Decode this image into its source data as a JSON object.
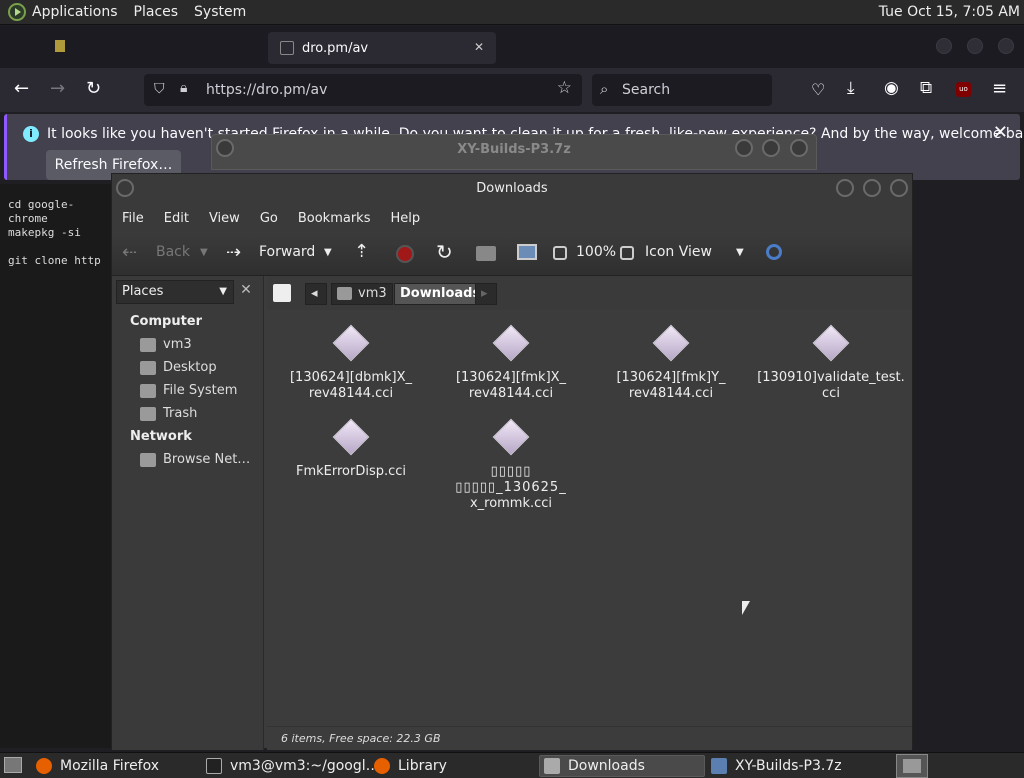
{
  "top_panel": {
    "menus": [
      "Applications",
      "Places",
      "System"
    ],
    "clock": "Tue Oct 15,  7:05 AM"
  },
  "firefox": {
    "tab_title": "dro.pm/av",
    "tab_close": "✕",
    "url": "https://dro.pm/av",
    "search_placeholder": "Search",
    "notice": "It looks like you haven't started Firefox in a while. Do you want to clean it up for a fresh, like-new experience? And by the way, welcome back!",
    "refresh_button": "Refresh Firefox…",
    "notice_close": "✕"
  },
  "terminal": {
    "lines": [
      "cd google-chrome",
      "makepkg -si",
      "",
      "git clone http"
    ]
  },
  "xy_window": {
    "title": "XY-Builds-P3.7z"
  },
  "caja": {
    "title": "Downloads",
    "menu": [
      "File",
      "Edit",
      "View",
      "Go",
      "Bookmarks",
      "Help"
    ],
    "toolbar": {
      "back": "Back",
      "forward": "Forward",
      "zoom": "100%",
      "view_mode": "Icon View"
    },
    "sidebar": {
      "selector": "Places",
      "computer_heading": "Computer",
      "computer_items": [
        "vm3",
        "Desktop",
        "File System",
        "Trash"
      ],
      "network_heading": "Network",
      "network_items": [
        "Browse Net…"
      ]
    },
    "pathbar": {
      "parent": "vm3",
      "current": "Downloads"
    },
    "files": [
      {
        "line1": "[130624][dbmk]X_",
        "line2": "rev48144.cci",
        "line3": ""
      },
      {
        "line1": "[130624][fmk]X_",
        "line2": "rev48144.cci",
        "line3": ""
      },
      {
        "line1": "[130624][fmk]Y_",
        "line2": "rev48144.cci",
        "line3": ""
      },
      {
        "line1": "[130910]validate_test.",
        "line2": "cci",
        "line3": ""
      },
      {
        "line1": "FmkErrorDisp.cci",
        "line2": "",
        "line3": ""
      },
      {
        "line1": "▯▯▯▯▯",
        "line2": "▯▯▯▯▯_130625_",
        "line3": "x_rommk.cci"
      }
    ],
    "status": "6 items, Free space: 22.3 GB"
  },
  "taskbar": {
    "items": [
      "Mozilla Firefox",
      "vm3@vm3:~/googl…",
      "Library",
      "Downloads",
      "XY-Builds-P3.7z"
    ]
  }
}
